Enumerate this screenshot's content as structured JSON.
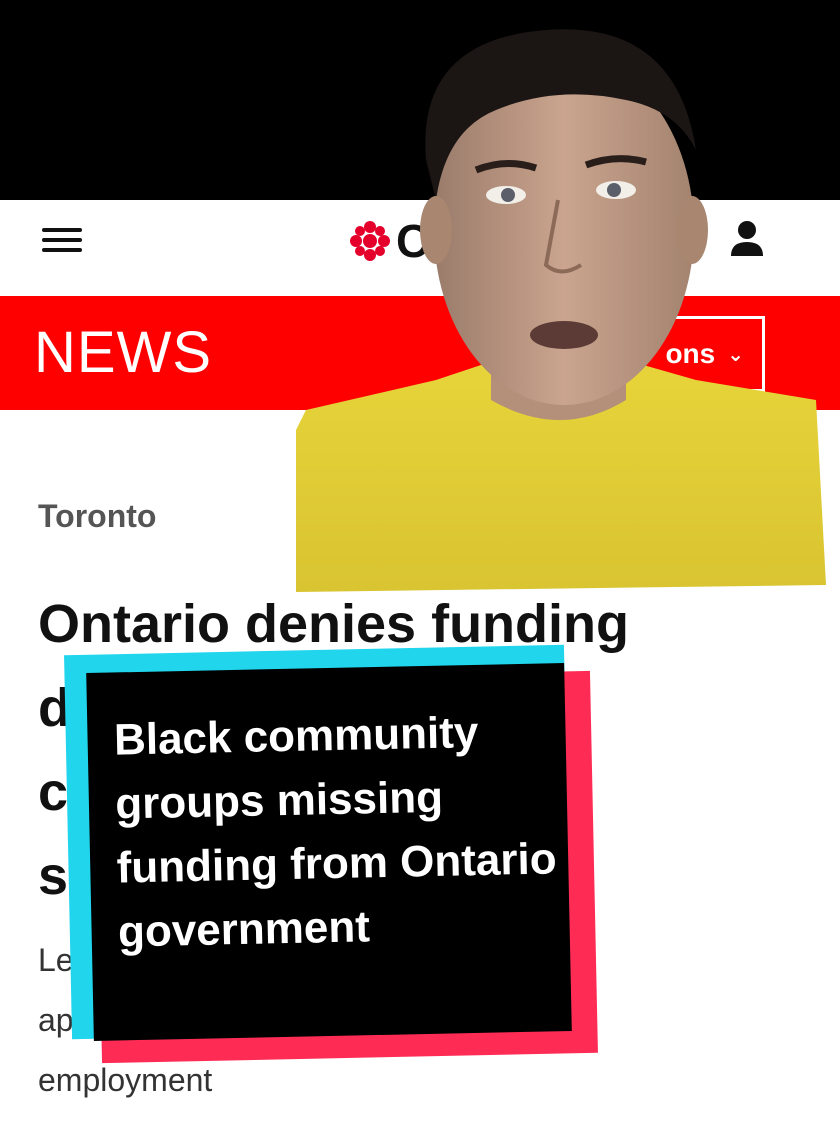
{
  "site": {
    "logo_text": "C",
    "brand_color": "#ff0000"
  },
  "header": {
    "menu_icon": "hamburger-menu-icon",
    "user_icon": "user-icon"
  },
  "news_bar": {
    "title": "NEWS",
    "sections_label": "ons",
    "sections_chevron": "⌄"
  },
  "article": {
    "location": "Toronto",
    "headline_lines": [
      "Ontario denies funding",
      "d",
      "c                              as",
      "s                                n'"
    ],
    "dek_lines": [
      "Le                                        efined",
      "ap",
      "employment"
    ]
  },
  "caption": {
    "text": "Black community groups missing funding from Ontario government",
    "colors": {
      "cyan": "#20d5ec",
      "red": "#fe2c55",
      "box": "#000000"
    }
  }
}
